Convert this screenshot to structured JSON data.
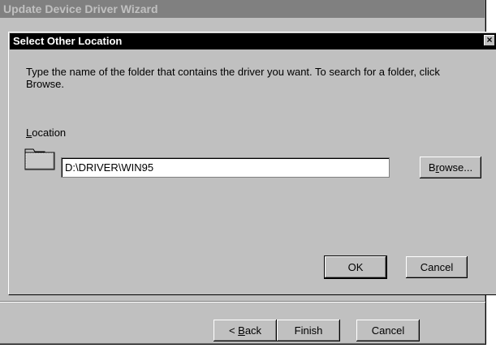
{
  "wizard": {
    "title": "Update Device Driver Wizard",
    "back_label": {
      "pre": "< ",
      "u": "B",
      "post": "ack"
    },
    "finish_label": "Finish",
    "cancel_label": "Cancel"
  },
  "dialog": {
    "title": "Select Other Location",
    "close_label": "×",
    "instructions": "Type the name of the folder that contains the driver you want. To search for a folder, click Browse.",
    "location_label": {
      "u": "L",
      "post": "ocation"
    },
    "location_value": "D:\\DRIVER\\WIN95",
    "browse_label": {
      "pre": "B",
      "u": "r",
      "post": "owse..."
    },
    "ok_label": "OK",
    "cancel_label": "Cancel"
  },
  "icons": {
    "folder": "folder-icon",
    "close": "close-icon"
  },
  "colors": {
    "title_active": "#000000",
    "title_inactive": "#808080",
    "face": "#c0c0c0"
  }
}
